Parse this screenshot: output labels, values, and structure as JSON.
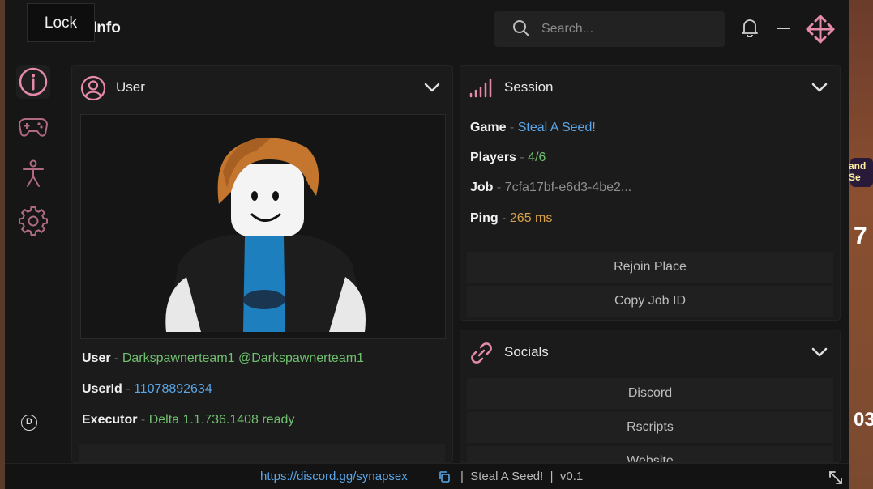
{
  "window": {
    "title": "Info",
    "lock_tooltip": "Lock"
  },
  "search": {
    "placeholder": "Search..."
  },
  "user_panel": {
    "title": "User",
    "user_label": "User",
    "user_value": "Darkspawnerteam1 @Darkspawnerteam1",
    "userid_label": "UserId",
    "userid_value": "11078892634",
    "executor_label": "Executor",
    "executor_value": "Delta 1.1.736.1408  ready"
  },
  "session_panel": {
    "title": "Session",
    "game_label": "Game",
    "game_value": "Steal A Seed!",
    "players_label": "Players",
    "players_value": "4/6",
    "job_label": "Job",
    "job_value": "7cfa17bf-e6d3-4be2...",
    "ping_label": "Ping",
    "ping_value": "265 ms",
    "rejoin_label": "Rejoin Place",
    "copy_job_label": "Copy Job ID"
  },
  "socials_panel": {
    "title": "Socials",
    "discord_label": "Discord",
    "rscripts_label": "Rscripts",
    "website_label": "Website"
  },
  "footer": {
    "link": "https://discord.gg/synapsex",
    "game": "Steal A Seed!",
    "version": "v0.1"
  },
  "background": {
    "num_a": "7",
    "num_b": "03",
    "badge_text": "and Se"
  },
  "colors": {
    "accent": "#e58aa8",
    "green": "#6fbf6f",
    "blue": "#5aa6e6",
    "orange": "#d9a04a"
  }
}
